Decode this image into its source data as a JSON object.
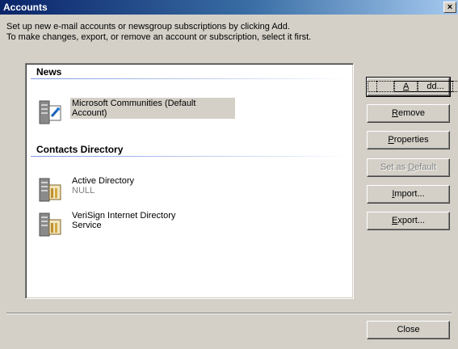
{
  "window": {
    "title": "Accounts",
    "close_glyph": "×"
  },
  "instructions": {
    "line1": "Set up new e-mail accounts or newsgroup subscriptions by clicking Add.",
    "line2": "To make changes, export, or remove an account or subscription, select it first."
  },
  "groups": [
    {
      "header": "News",
      "items": [
        {
          "name": "Microsoft Communities (Default",
          "name2": "Account)",
          "icon": "news-server-icon"
        }
      ]
    },
    {
      "header": "Contacts Directory",
      "items": [
        {
          "name": "Active Directory",
          "sub": "NULL",
          "icon": "directory-server-icon"
        },
        {
          "name": "VeriSign Internet Directory",
          "name2": "Service",
          "icon": "directory-server-icon"
        }
      ]
    }
  ],
  "buttons": {
    "add": {
      "pre": "",
      "key": "A",
      "post": "dd..."
    },
    "remove": {
      "pre": "",
      "key": "R",
      "post": "emove"
    },
    "properties": {
      "pre": "",
      "key": "P",
      "post": "roperties"
    },
    "set_default": {
      "pre": "Set as ",
      "key": "D",
      "post": "efault"
    },
    "import": {
      "pre": "",
      "key": "I",
      "post": "mport..."
    },
    "export": {
      "pre": "",
      "key": "E",
      "post": "xport..."
    },
    "close": "Close"
  }
}
